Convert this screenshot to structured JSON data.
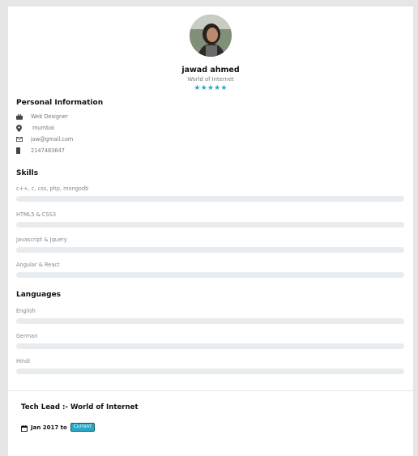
{
  "profile": {
    "name": "jawad ahmed",
    "subtitle": "World of Internet",
    "stars": "★★★★★",
    "rating": 5
  },
  "personal_info": {
    "heading": "Personal Information",
    "items": [
      {
        "icon": "briefcase-icon",
        "text": "Web Designer"
      },
      {
        "icon": "location-pin-icon",
        "text": "mumbai"
      },
      {
        "icon": "mail-icon",
        "text": "jaw@gmail.com"
      },
      {
        "icon": "phone-icon",
        "text": "2147483647"
      }
    ]
  },
  "skills": {
    "heading": "Skills",
    "items": [
      {
        "label": "c++, c, css, php, mongodb",
        "level": 0
      },
      {
        "label": "HTML5 & CSS3",
        "level": 0
      },
      {
        "label": "Javascript & Jquery",
        "level": 0
      },
      {
        "label": "Angular & React",
        "level": 0
      }
    ]
  },
  "languages": {
    "heading": "Languages",
    "items": [
      {
        "label": "English",
        "level": 0
      },
      {
        "label": "German",
        "level": 0
      },
      {
        "label": "Hindi",
        "level": 0
      }
    ]
  },
  "experience": {
    "title": "Tech Lead :- World of Internet",
    "date": "Jan 2017 to",
    "badge": "Current",
    "icon": "calendar-icon"
  },
  "colors": {
    "accent": "#2aa6c6",
    "bar_track": "#e8ecef",
    "page_bg": "#e6e6e6"
  }
}
